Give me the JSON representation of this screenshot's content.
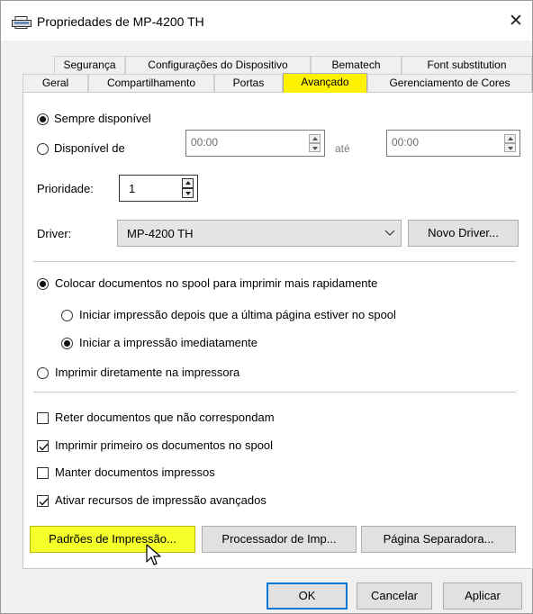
{
  "window": {
    "title": "Propriedades de MP-4200 TH",
    "close_glyph": "✕",
    "icon": "printer-icon"
  },
  "tabs_row1": [
    "Segurança",
    "Configurações do Dispositivo",
    "Bematech",
    "Font substitution"
  ],
  "tabs_row2": [
    "Geral",
    "Compartilhamento",
    "Portas",
    "Avançado",
    "Gerenciamento de Cores"
  ],
  "active_tab": "Avançado",
  "availability": {
    "always_label": "Sempre disponível",
    "from_label": "Disponível de",
    "from_value": "00:00",
    "until_label": "até",
    "until_value": "00:00",
    "selected": "always"
  },
  "priority": {
    "label": "Prioridade:",
    "value": "1"
  },
  "driver": {
    "label": "Driver:",
    "value": "MP-4200 TH",
    "new_driver_button": "Novo Driver..."
  },
  "spool": {
    "spool_label": "Colocar documentos no spool para imprimir mais rapidamente",
    "start_after_last_label": "Iniciar impressão depois que a última página estiver no spool",
    "start_immediately_label": "Iniciar a impressão imediatamente",
    "direct_label": "Imprimir diretamente na impressora"
  },
  "checkboxes": [
    {
      "label": "Reter documentos que não correspondam",
      "checked": false
    },
    {
      "label": "Imprimir primeiro os documentos no spool",
      "checked": true
    },
    {
      "label": "Manter documentos impressos",
      "checked": false
    },
    {
      "label": "Ativar recursos de impressão avançados",
      "checked": true
    }
  ],
  "buttons": {
    "printing_defaults": "Padrões de Impressão...",
    "print_processor": "Processador de Imp...",
    "separator_page": "Página Separadora...",
    "ok": "OK",
    "cancel": "Cancelar",
    "apply": "Aplicar"
  },
  "colors": {
    "highlight": "#fff200",
    "accent": "#0078d7"
  }
}
